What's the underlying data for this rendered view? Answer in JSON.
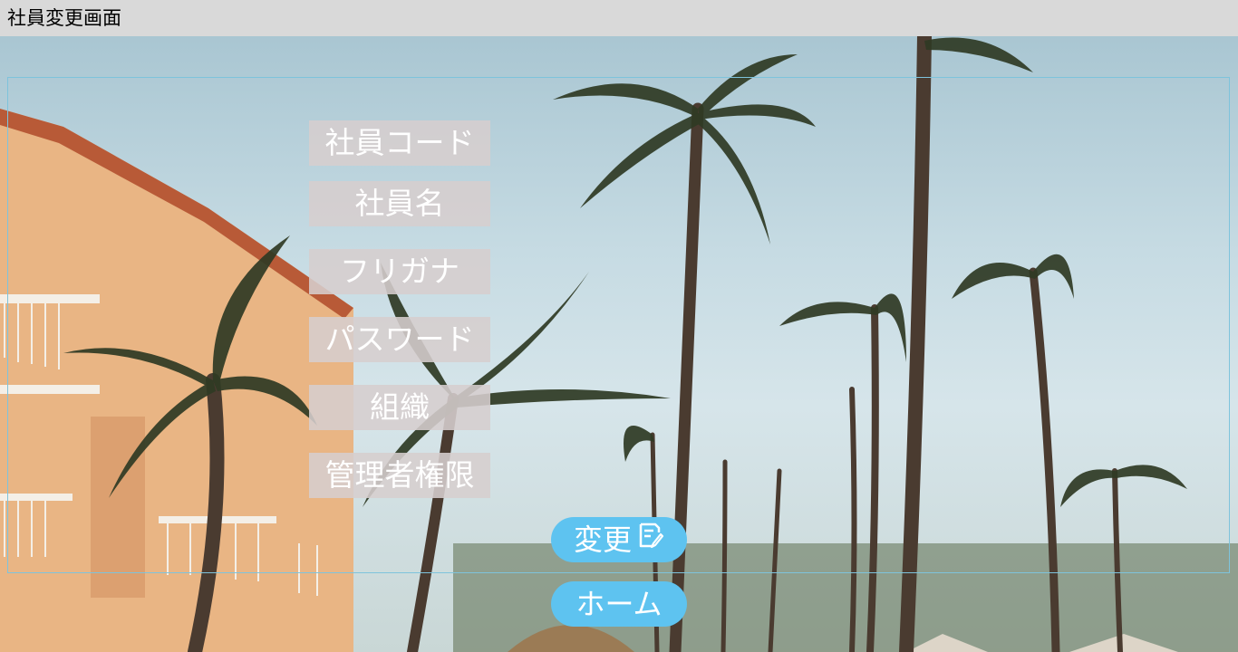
{
  "window": {
    "title": "社員変更画面"
  },
  "form": {
    "fields": [
      {
        "label": "社員コード"
      },
      {
        "label": "社員名"
      },
      {
        "label": "フリガナ"
      },
      {
        "label": "パスワード"
      },
      {
        "label": "組織"
      },
      {
        "label": "管理者権限"
      }
    ]
  },
  "buttons": {
    "change_label": "変更",
    "change_icon": "edit-note-icon",
    "home_label": "ホーム"
  },
  "colors": {
    "titlebar_bg": "#d9d9d9",
    "label_bg": "#d6cece",
    "button_bg": "#5ec3f0",
    "frame_border": "#7ec3dc"
  }
}
